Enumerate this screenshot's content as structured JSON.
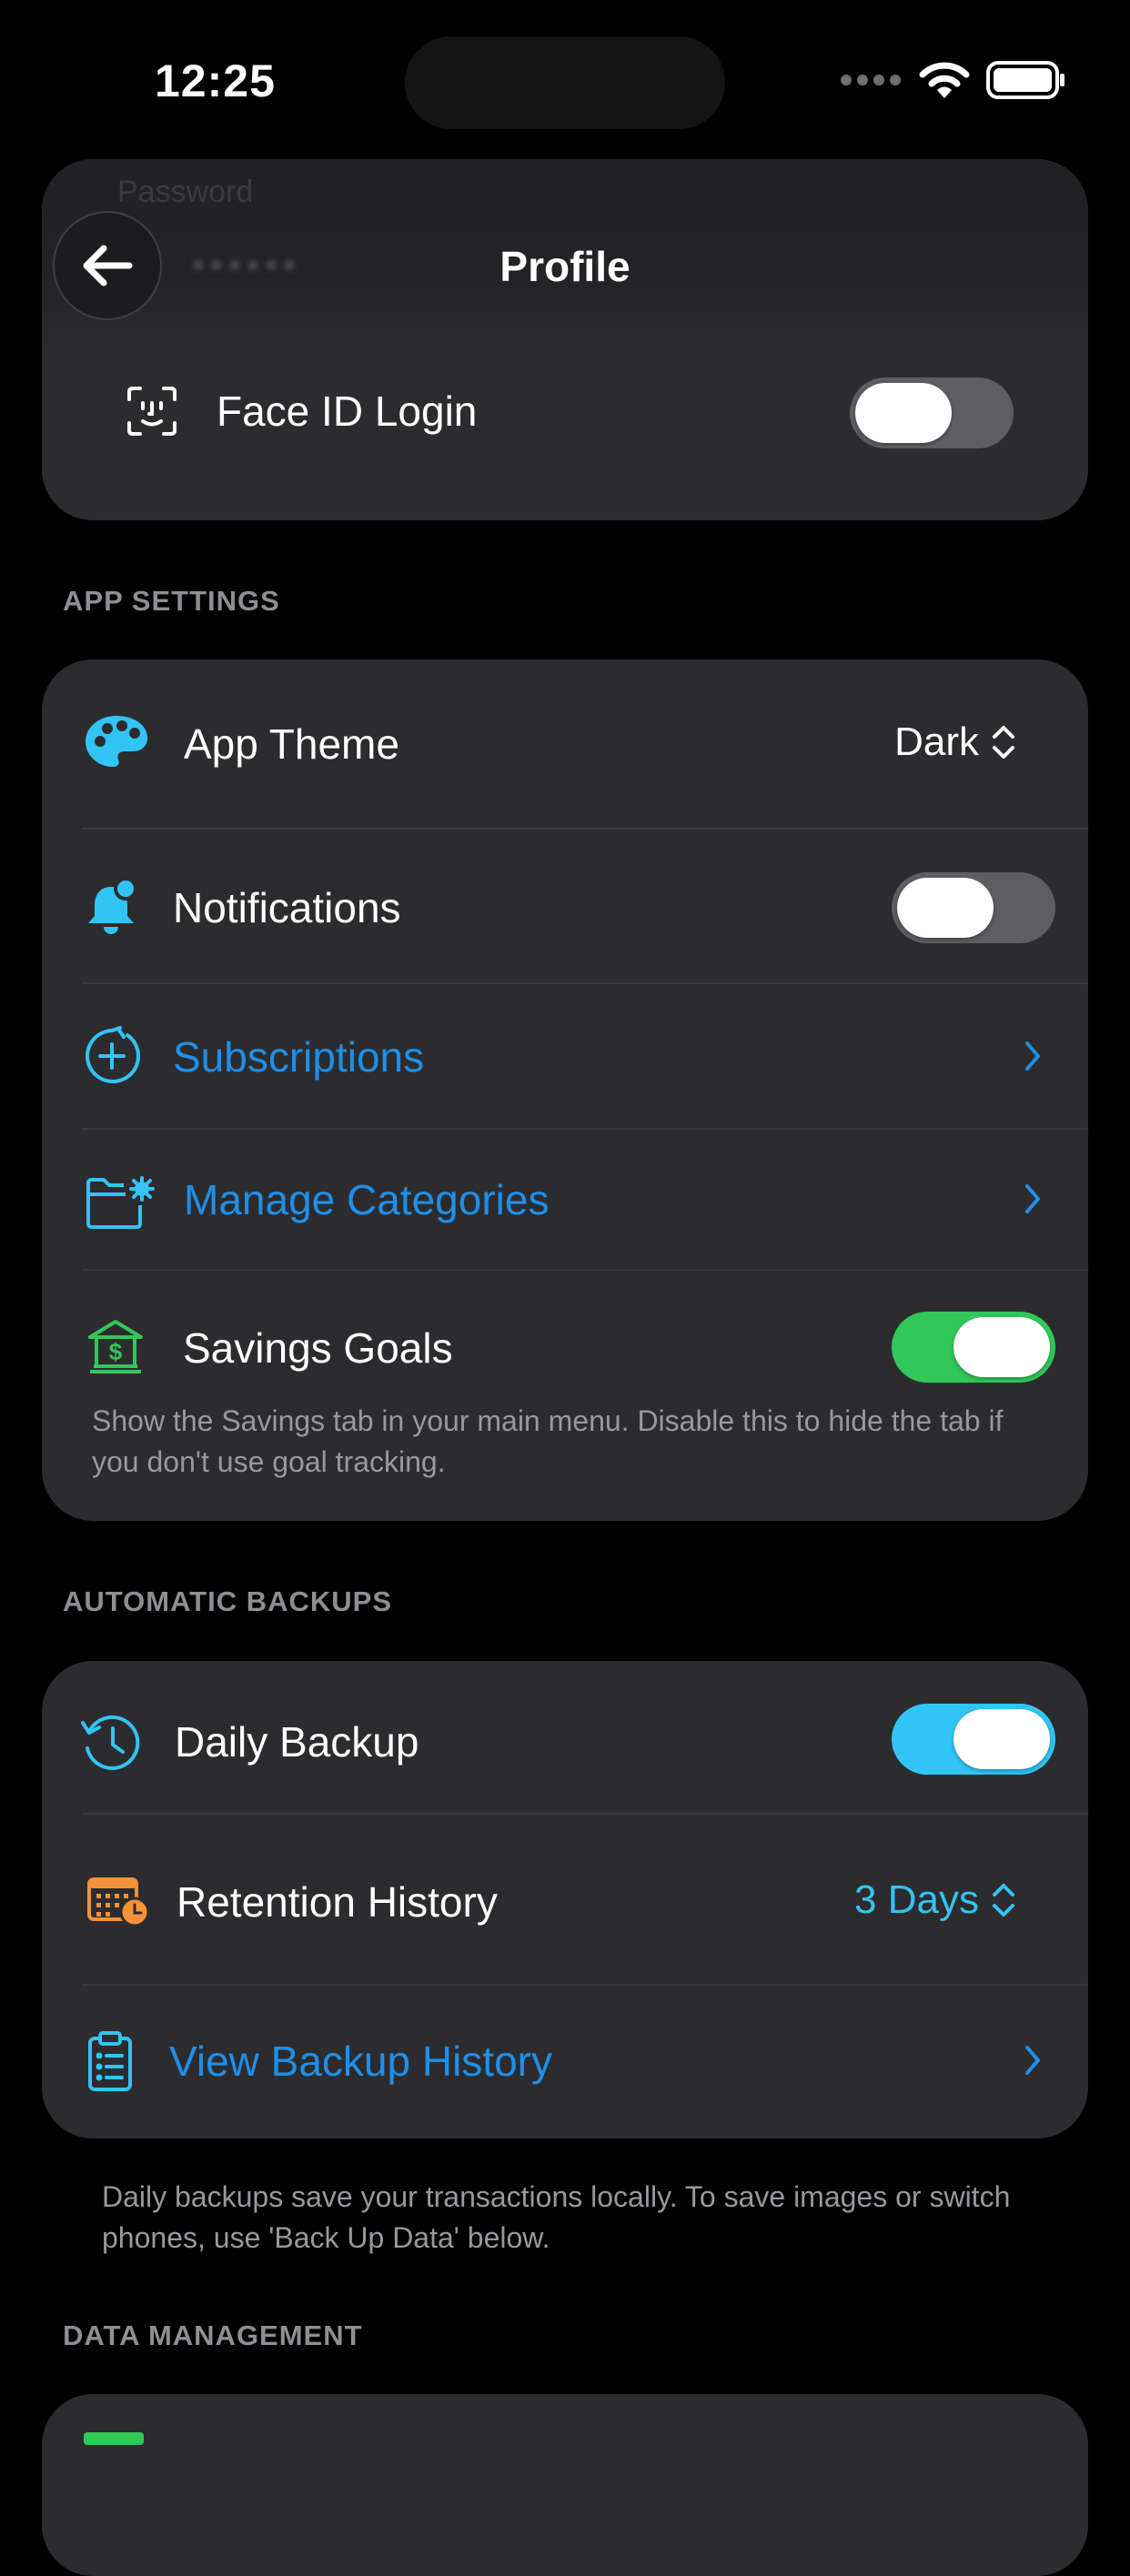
{
  "status": {
    "time": "12:25"
  },
  "nav": {
    "title": "Profile",
    "ghost_label": "Password",
    "ghost_value": "••••••"
  },
  "security": {
    "face_id_label": "Face ID Login",
    "face_id_on": false
  },
  "app_settings": {
    "header": "APP SETTINGS",
    "theme_label": "App Theme",
    "theme_value": "Dark",
    "notifications_label": "Notifications",
    "notifications_on": false,
    "subscriptions_label": "Subscriptions",
    "categories_label": "Manage Categories",
    "savings_label": "Savings Goals",
    "savings_on": true,
    "savings_note": "Show the Savings tab in your main menu. Disable this to hide the tab if you don't use goal tracking."
  },
  "backups": {
    "header": "AUTOMATIC BACKUPS",
    "daily_label": "Daily Backup",
    "daily_on": true,
    "retention_label": "Retention History",
    "retention_value": "3 Days",
    "history_label": "View Backup History",
    "note": "Daily backups save your transactions locally. To save images or switch phones, use 'Back Up Data' below."
  },
  "data_management": {
    "header": "DATA MANAGEMENT"
  },
  "colors": {
    "accent_blue": "#1f8fe9",
    "icon_cyan": "#32c4f5",
    "green": "#32c759",
    "orange": "#f5923a",
    "card": "#2c2c2e"
  },
  "icons": [
    "arrow-left-icon",
    "face-id-icon",
    "palette-icon",
    "bell-icon",
    "subscription-icon",
    "folder-gear-icon",
    "bank-icon",
    "clock-history-icon",
    "calendar-clock-icon",
    "clipboard-list-icon",
    "wifi-icon",
    "battery-icon",
    "signal-icon",
    "up-down-chevron-icon",
    "chevron-right-icon"
  ]
}
